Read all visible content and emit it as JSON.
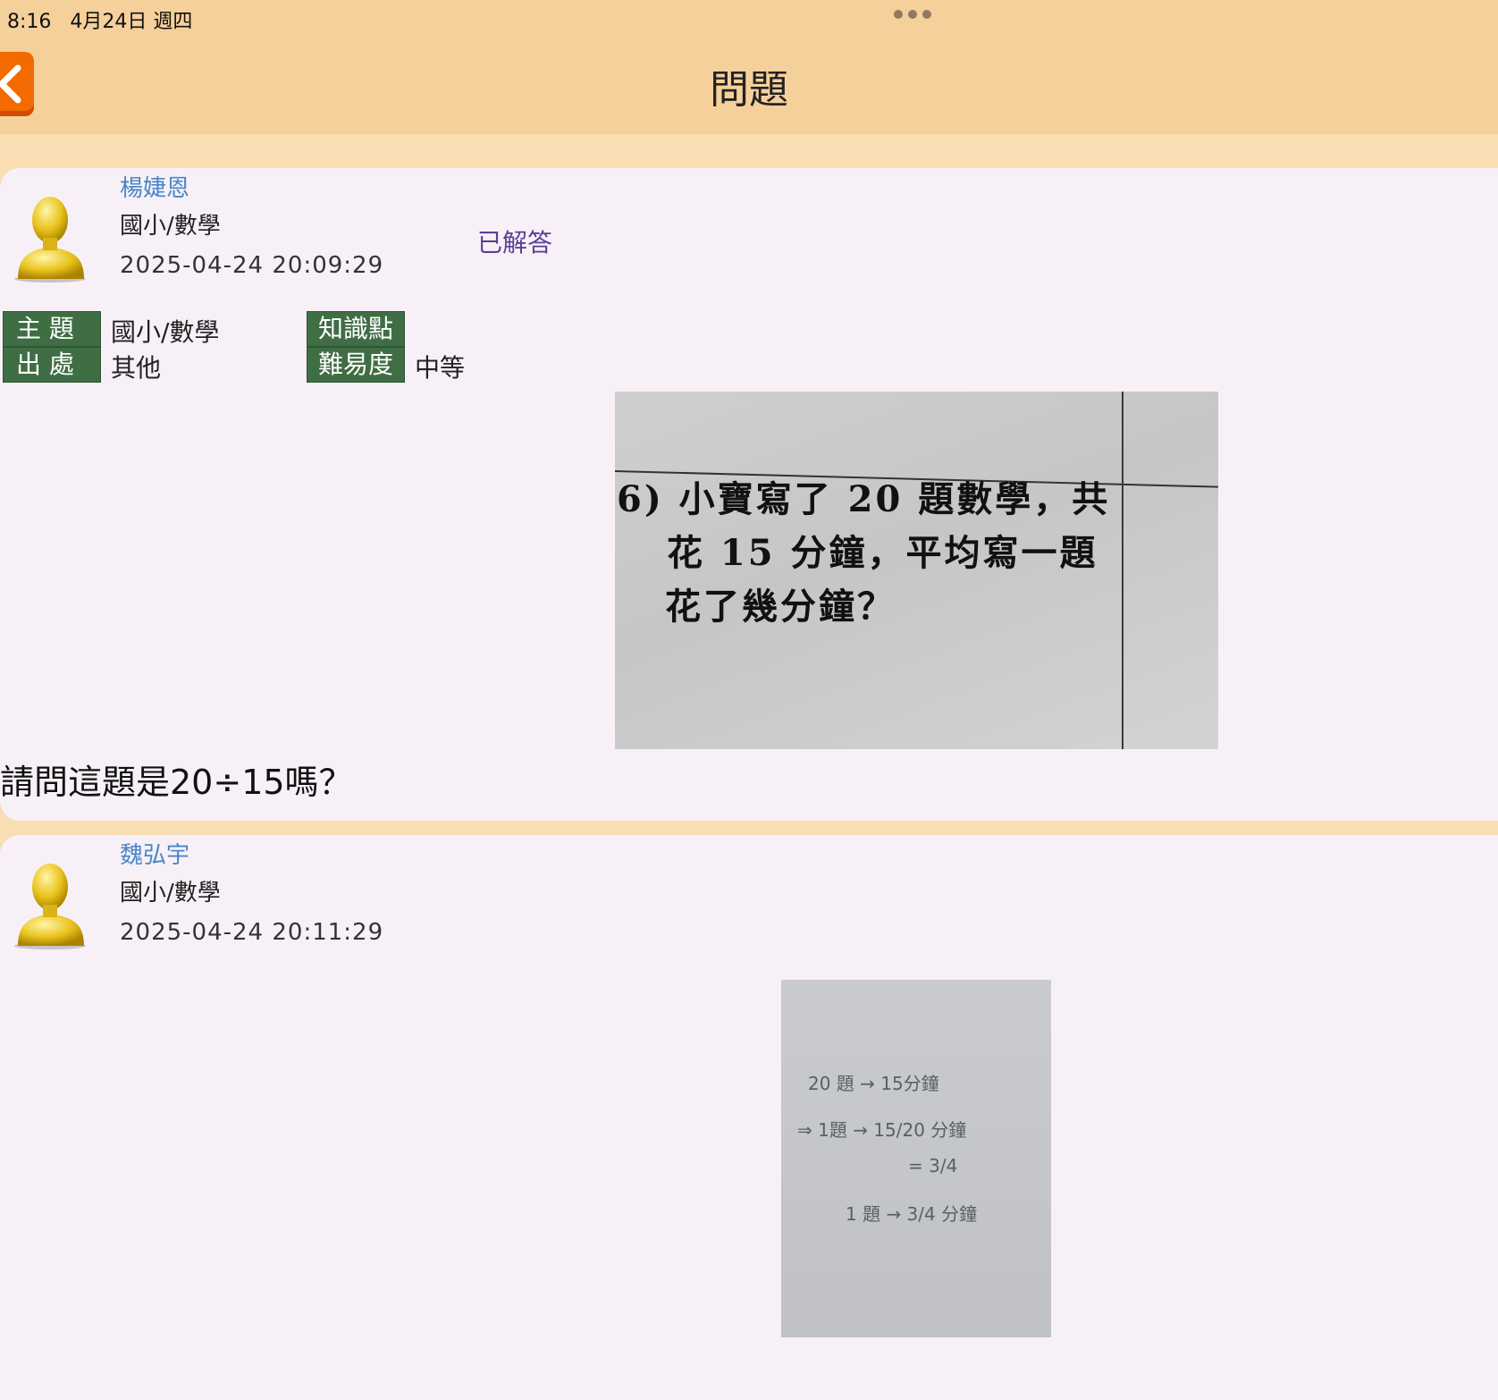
{
  "status_bar": {
    "time": "8:16",
    "date": "4月24日 週四"
  },
  "nav": {
    "title": "問題"
  },
  "question": {
    "author": "楊婕恩",
    "subject": "國小/數學",
    "timestamp": "2025-04-24 20:09:29",
    "status": "已解答",
    "tags": {
      "topic_label": "主 題",
      "topic_value": "國小/數學",
      "source_label": "出 處",
      "source_value": "其他",
      "knowledge_label": "知識點",
      "knowledge_value": "",
      "difficulty_label": "難易度",
      "difficulty_value": "中等"
    },
    "image_text": {
      "line1": "6) 小寶寫了 20 題數學，共",
      "line2": "花 15 分鐘，平均寫一題",
      "line3": "花了幾分鐘？"
    },
    "text": "請問這題是20÷15嗎？"
  },
  "answer": {
    "author": "魏弘宇",
    "subject": "國小/數學",
    "timestamp": "2025-04-24 20:11:29",
    "image_text": {
      "line1": "20 題 → 15分鐘",
      "line2": "⇒  1題 → 15/20 分鐘",
      "line3": "= 3/4",
      "line4": "1 題 → 3/4 分鐘"
    }
  }
}
